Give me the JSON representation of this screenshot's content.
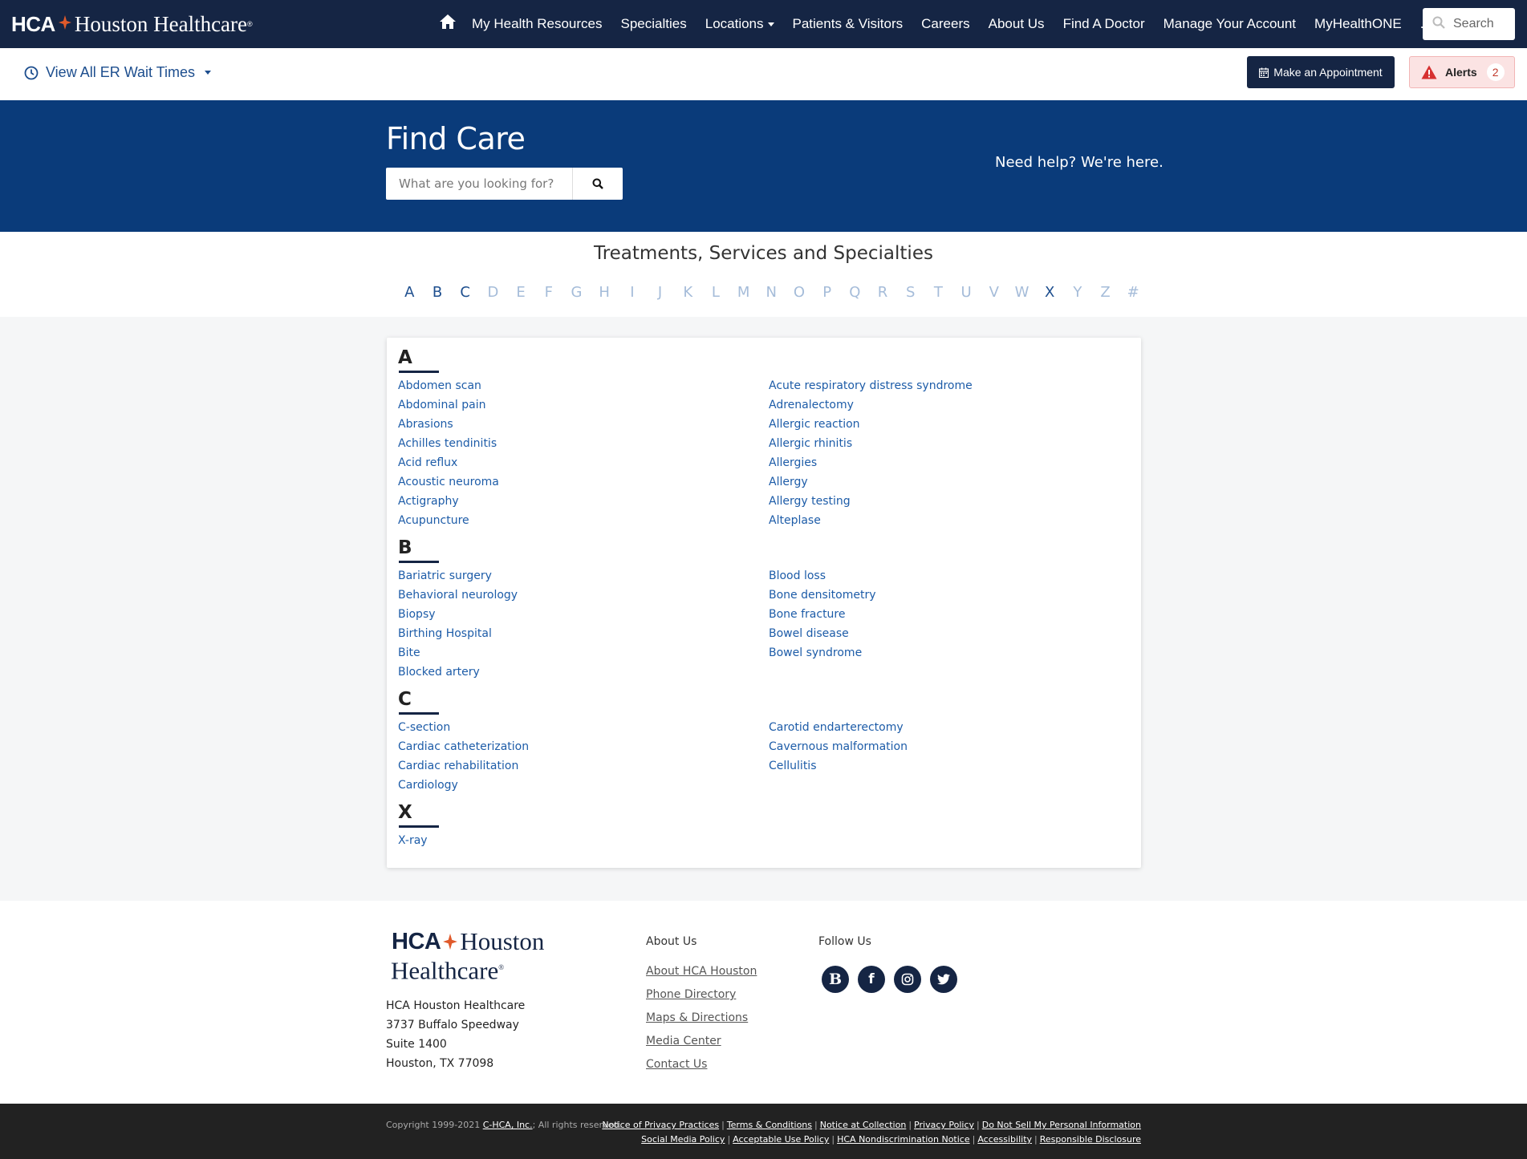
{
  "brand": {
    "hca": "HCA",
    "name": "Houston Healthcare",
    "reg": "®",
    "line1": "Houston",
    "line2": "Healthcare",
    "colors": {
      "navy": "#152544",
      "blue": "#0a3b7a",
      "link": "#1d5ca8",
      "accent": "#e05a2b"
    }
  },
  "nav": {
    "home_icon": "home-icon",
    "links": [
      {
        "label": "My Health Resources"
      },
      {
        "label": "Specialties"
      },
      {
        "label": "Locations",
        "dropdown": true
      },
      {
        "label": "Patients & Visitors"
      },
      {
        "label": "Careers"
      },
      {
        "label": "About Us"
      },
      {
        "label": "Find A Doctor"
      },
      {
        "label": "Manage Your Account"
      },
      {
        "label": "MyHealthONE"
      },
      {
        "label": "..."
      }
    ],
    "search_label": "Search"
  },
  "subbar": {
    "er_label": "View All ER Wait Times",
    "appointment_label": "Make an Appointment",
    "alerts_label": "Alerts",
    "alerts_count": "2"
  },
  "hero": {
    "title": "Find Care",
    "search_placeholder": "What are you looking for?",
    "help_text": "Need help? We're here."
  },
  "index": {
    "title": "Treatments, Services and Specialties",
    "letters": [
      {
        "l": "A",
        "active": true
      },
      {
        "l": "B",
        "active": true
      },
      {
        "l": "C",
        "active": true
      },
      {
        "l": "D",
        "active": false
      },
      {
        "l": "E",
        "active": false
      },
      {
        "l": "F",
        "active": false
      },
      {
        "l": "G",
        "active": false
      },
      {
        "l": "H",
        "active": false
      },
      {
        "l": "I",
        "active": false
      },
      {
        "l": "J",
        "active": false
      },
      {
        "l": "K",
        "active": false
      },
      {
        "l": "L",
        "active": false
      },
      {
        "l": "M",
        "active": false
      },
      {
        "l": "N",
        "active": false
      },
      {
        "l": "O",
        "active": false
      },
      {
        "l": "P",
        "active": false
      },
      {
        "l": "Q",
        "active": false
      },
      {
        "l": "R",
        "active": false
      },
      {
        "l": "S",
        "active": false
      },
      {
        "l": "T",
        "active": false
      },
      {
        "l": "U",
        "active": false
      },
      {
        "l": "V",
        "active": false
      },
      {
        "l": "W",
        "active": false
      },
      {
        "l": "X",
        "active": true
      },
      {
        "l": "Y",
        "active": false
      },
      {
        "l": "Z",
        "active": false
      },
      {
        "l": "#",
        "active": false
      }
    ],
    "groups": [
      {
        "letter": "A",
        "left": [
          "Abdomen scan",
          "Abdominal pain",
          "Abrasions",
          "Achilles tendinitis",
          "Acid reflux",
          "Acoustic neuroma",
          "Actigraphy",
          "Acupuncture"
        ],
        "right": [
          "Acute respiratory distress syndrome",
          "Adrenalectomy",
          "Allergic reaction",
          "Allergic rhinitis",
          "Allergies",
          "Allergy",
          "Allergy testing",
          "Alteplase"
        ]
      },
      {
        "letter": "B",
        "left": [
          "Bariatric surgery",
          "Behavioral neurology",
          "Biopsy",
          "Birthing Hospital",
          "Bite",
          "Blocked artery"
        ],
        "right": [
          "Blood loss",
          "Bone densitometry",
          "Bone fracture",
          "Bowel disease",
          "Bowel syndrome"
        ]
      },
      {
        "letter": "C",
        "left": [
          "C-section",
          "Cardiac catheterization",
          "Cardiac rehabilitation",
          "Cardiology"
        ],
        "right": [
          "Carotid endarterectomy",
          "Cavernous malformation",
          "Cellulitis"
        ]
      },
      {
        "letter": "X",
        "left": [
          "X-ray"
        ],
        "right": []
      }
    ]
  },
  "footer": {
    "address": [
      "HCA Houston Healthcare",
      "3737 Buffalo Speedway",
      "Suite 1400",
      "Houston, TX 77098"
    ],
    "about_title": "About Us",
    "about_links": [
      "About HCA Houston",
      "Phone Directory",
      "Maps & Directions",
      "Media Center",
      "Contact Us"
    ],
    "follow_title": "Follow Us",
    "social": [
      {
        "icon": "blog-icon",
        "glyph": "B"
      },
      {
        "icon": "facebook-icon",
        "glyph": "f"
      },
      {
        "icon": "instagram-icon",
        "glyph": ""
      },
      {
        "icon": "twitter-icon",
        "glyph": ""
      }
    ]
  },
  "legal": {
    "copyright_prefix": "Copyright 1999-2021 ",
    "copyright_link": "C-HCA, Inc.",
    "copyright_suffix": "; All rights reserved.",
    "row1": [
      "Notice of Privacy Practices",
      "Terms & Conditions",
      "Notice at Collection",
      "Privacy Policy",
      "Do Not Sell My Personal Information"
    ],
    "row2": [
      "Social Media Policy",
      "Acceptable Use Policy",
      "HCA Nondiscrimination Notice",
      "Accessibility",
      "Responsible Disclosure"
    ]
  }
}
